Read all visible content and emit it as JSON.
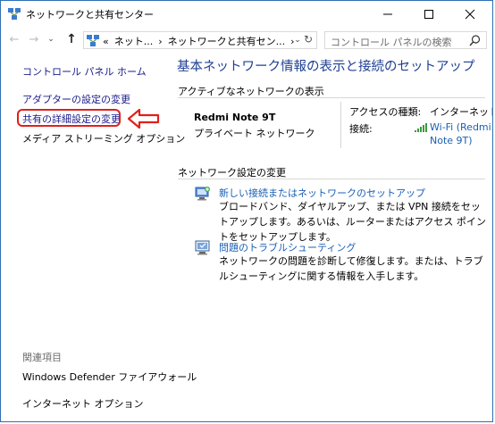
{
  "window": {
    "title": "ネットワークと共有センター",
    "min_glyph": "—",
    "max_glyph": "☐",
    "close_glyph": "✕"
  },
  "nav": {
    "back_glyph": "←",
    "forward_glyph": "→",
    "recent_glyph": "⌄",
    "up_glyph": "↑",
    "breadcrumb": [
      "«",
      "ネット...",
      "›",
      "ネットワークと共有セン...",
      "›"
    ],
    "dropdown_glyph": "⌄",
    "refresh_glyph": "↻",
    "search_placeholder": "コントロール パネルの検索"
  },
  "left_pane": {
    "home": "コントロール パネル ホーム",
    "adapter": "アダプターの設定の変更",
    "sharing": "共有の詳細設定の変更",
    "media": "メディア ストリーミング オプション",
    "related_heading": "関連項目",
    "defender": "Windows Defender ファイアウォール",
    "internet_options": "インターネット オプション"
  },
  "main": {
    "title": "基本ネットワーク情報の表示と接続のセットアップ",
    "active_heading": "アクティブなネットワークの表示",
    "network_name": "Redmi Note 9T",
    "network_profile": "プライベート ネットワーク",
    "access_label": "アクセスの種類:",
    "access_value": "インターネット",
    "connection_label": "接続:",
    "connection_value_line1": "Wi-Fi (Redmi",
    "connection_value_line2": "Note 9T)",
    "change_heading": "ネットワーク設定の変更",
    "task1_link": "新しい接続またはネットワークのセットアップ",
    "task1_desc": "ブロードバンド、ダイヤルアップ、または VPN 接続をセットアップします。あるいは、ルーターまたはアクセス ポイントをセットアップします。",
    "task2_link": "問題のトラブルシューティング",
    "task2_desc": "ネットワークの問題を診断して修復します。または、トラブルシューティングに関する情報を入手します。"
  },
  "colors": {
    "accent_title": "#1e3f93",
    "link": "#1a5fb4",
    "highlight": "#e0201b"
  }
}
